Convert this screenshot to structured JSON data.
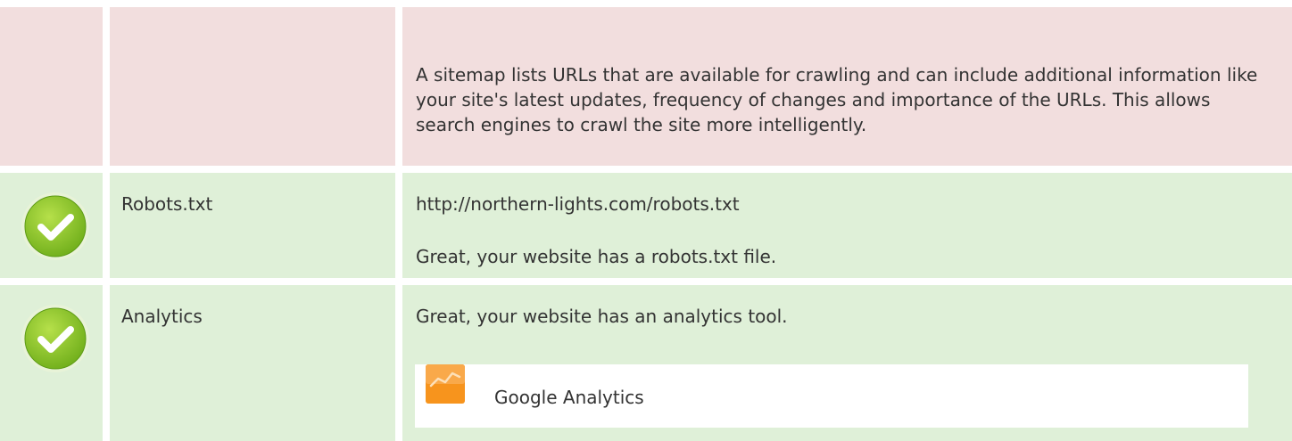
{
  "sitemap": {
    "description": "A sitemap lists URLs that are available for crawling and can include additional information like your site's latest updates, frequency of changes and importance of the URLs. This allows search engines to crawl the site more intelligently."
  },
  "robots": {
    "label": "Robots.txt",
    "url": "http://northern-lights.com/robots.txt",
    "message": "Great, your website has a robots.txt file.",
    "status_icon": "check-icon"
  },
  "analytics": {
    "label": "Analytics",
    "message": "Great, your website has an analytics tool.",
    "status_icon": "check-icon",
    "tools": [
      {
        "name": "Google Analytics",
        "icon": "google-analytics-icon"
      }
    ]
  },
  "colors": {
    "warning_row": "#f2dede",
    "success_row": "#dff0d8",
    "check_green": "#8cc63f",
    "analytics_orange": "#f7941d"
  }
}
